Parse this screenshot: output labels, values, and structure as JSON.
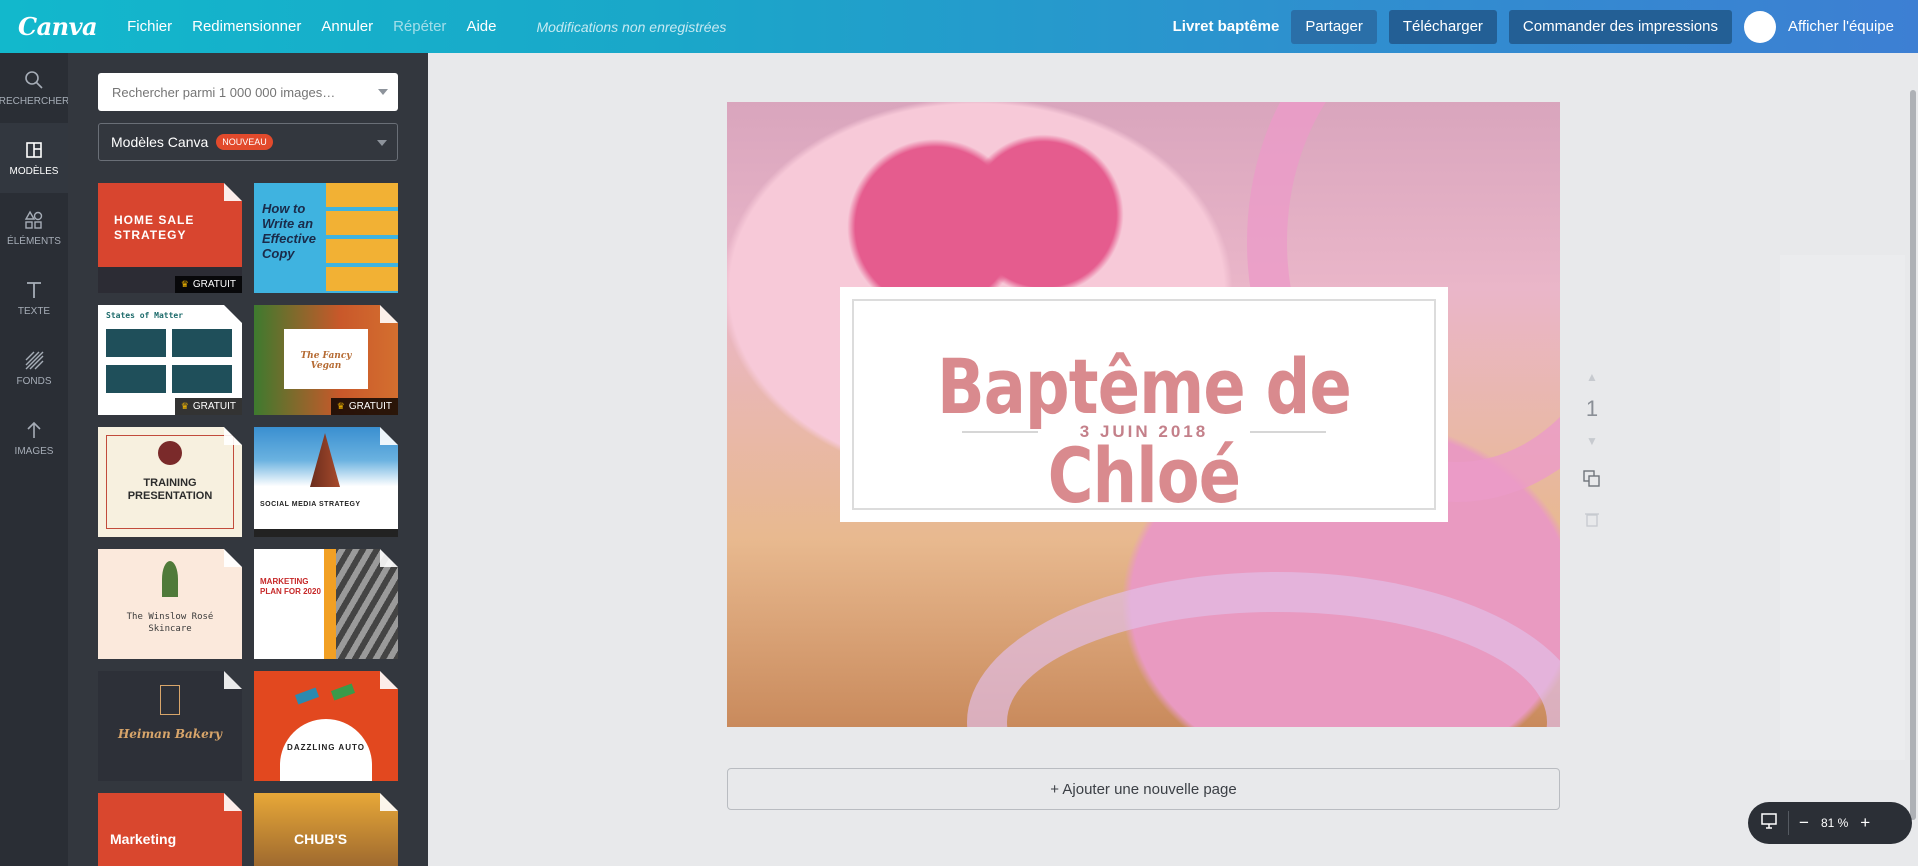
{
  "topbar": {
    "logo": "Canva",
    "menu": [
      "Fichier",
      "Redimensionner",
      "Annuler",
      "Répéter",
      "Aide"
    ],
    "status": "Modifications non enregistrées",
    "doc_title": "Livret baptême",
    "share": "Partager",
    "download": "Télécharger",
    "order_prints": "Commander des impressions",
    "team": "Afficher l'équipe"
  },
  "rail": [
    {
      "label": "RECHERCHER",
      "icon": "search-icon"
    },
    {
      "label": "MODÈLES",
      "icon": "layout-icon"
    },
    {
      "label": "ÉLÉMENTS",
      "icon": "shapes-icon"
    },
    {
      "label": "TEXTE",
      "icon": "text-icon"
    },
    {
      "label": "FONDS",
      "icon": "pattern-icon"
    },
    {
      "label": "IMAGES",
      "icon": "upload-icon"
    }
  ],
  "panel": {
    "search_placeholder": "Rechercher parmi 1 000 000 images…",
    "select_label": "Modèles Canva",
    "select_badge": "NOUVEAU",
    "free_label": "GRATUIT",
    "templates": [
      {
        "title": "HOME SALE STRATEGY",
        "free": true
      },
      {
        "title": "How to Write an Effective Copy",
        "free": false
      },
      {
        "title": "States of Matter",
        "free": true
      },
      {
        "title": "The Fancy Vegan",
        "free": true
      },
      {
        "title": "TRAINING PRESENTATION",
        "free": false
      },
      {
        "title": "SOCIAL MEDIA STRATEGY",
        "free": false
      },
      {
        "title": "The Winslow Rosé Skincare",
        "free": false
      },
      {
        "title": "MARKETING PLAN FOR 2020",
        "free": false
      },
      {
        "title": "Heiman Bakery",
        "free": false
      },
      {
        "title": "DAZZLING AUTO",
        "free": false
      },
      {
        "title": "Marketing",
        "free": false
      },
      {
        "title": "CHUB'S",
        "free": false
      }
    ]
  },
  "design": {
    "title": "Baptême de Chloé",
    "date": "3 JUIN 2018"
  },
  "page_number": "1",
  "add_page": "+ Ajouter une nouvelle page",
  "zoom": {
    "value": "81 %"
  }
}
